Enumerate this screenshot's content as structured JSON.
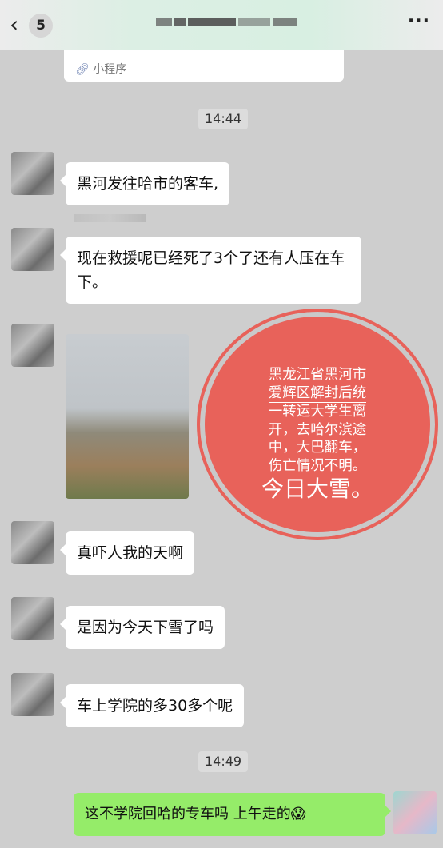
{
  "header": {
    "back_icon": "chevron-left",
    "unread_count": "5",
    "more_icon": "ellipsis"
  },
  "mini_program": {
    "label": "小程序",
    "icon": "mini-program-link"
  },
  "messages": {
    "time1": "14:44",
    "m1": "黑河发往哈市的客车,",
    "m2": "现在救援呢已经死了3个了还有人压在车下。",
    "image_overlay": {
      "lines": [
        "黑龙江省黑河市",
        "爱辉区解封后统",
        "一转运大学生离",
        "开，去哈尔滨途",
        "中，大巴翻车，",
        "伤亡情况不明。"
      ],
      "emphasis": "今日大雪。"
    },
    "m3": "真吓人我的天啊",
    "m4": "是因为今天下雪了吗",
    "m5": "车上学院的多30多个呢",
    "time2": "14:49",
    "own1": "这不学院回哈的专车吗 上午走的😱"
  },
  "colors": {
    "own_bubble": "#95ec69",
    "overlay_circle": "#e8625a"
  }
}
